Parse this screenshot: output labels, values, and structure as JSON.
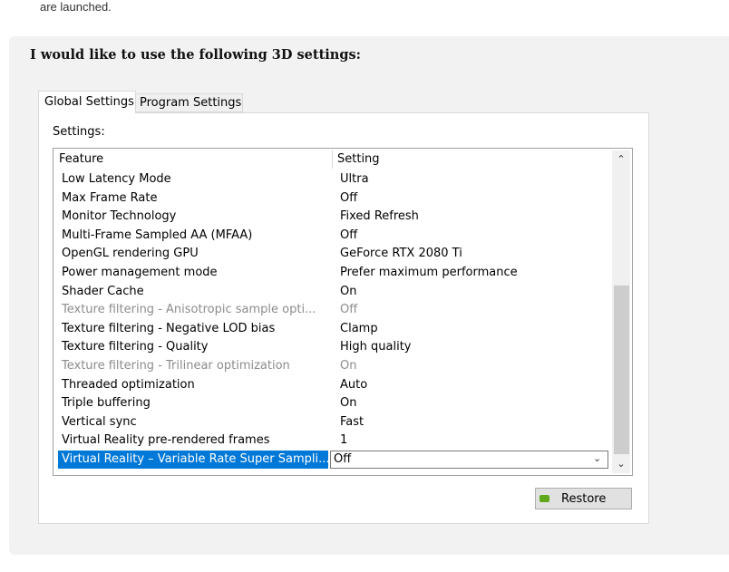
{
  "intro_text": "are launched.",
  "section_heading": "I would like to use the following 3D settings:",
  "tabs": [
    {
      "label": "Global Settings",
      "active": true
    },
    {
      "label": "Program Settings",
      "active": false
    }
  ],
  "settings_label": "Settings:",
  "columns": {
    "feature": "Feature",
    "setting": "Setting"
  },
  "rows": [
    {
      "feature": "Low Latency Mode",
      "setting": "Ultra",
      "disabled": false
    },
    {
      "feature": "Max Frame Rate",
      "setting": "Off",
      "disabled": false
    },
    {
      "feature": "Monitor Technology",
      "setting": "Fixed Refresh",
      "disabled": false
    },
    {
      "feature": "Multi-Frame Sampled AA (MFAA)",
      "setting": "Off",
      "disabled": false
    },
    {
      "feature": "OpenGL rendering GPU",
      "setting": "GeForce RTX 2080 Ti",
      "disabled": false
    },
    {
      "feature": "Power management mode",
      "setting": "Prefer maximum performance",
      "disabled": false
    },
    {
      "feature": "Shader Cache",
      "setting": "On",
      "disabled": false
    },
    {
      "feature": "Texture filtering - Anisotropic sample opti...",
      "setting": "Off",
      "disabled": true
    },
    {
      "feature": "Texture filtering - Negative LOD bias",
      "setting": "Clamp",
      "disabled": false
    },
    {
      "feature": "Texture filtering - Quality",
      "setting": "High quality",
      "disabled": false
    },
    {
      "feature": "Texture filtering - Trilinear optimization",
      "setting": "On",
      "disabled": true
    },
    {
      "feature": "Threaded optimization",
      "setting": "Auto",
      "disabled": false
    },
    {
      "feature": "Triple buffering",
      "setting": "On",
      "disabled": false
    },
    {
      "feature": "Vertical sync",
      "setting": "Fast",
      "disabled": false
    },
    {
      "feature": "Virtual Reality pre-rendered frames",
      "setting": "1",
      "disabled": false
    },
    {
      "feature": "Virtual Reality – Variable Rate Super Sampli...",
      "setting": "Off",
      "disabled": false,
      "selected": true
    }
  ],
  "restore_button": {
    "label": "Restore",
    "icon": "nvidia-icon"
  },
  "colors": {
    "selection": "#0078d7",
    "disabled_text": "#8c8c8c",
    "nvidia_green": "#76b900"
  }
}
